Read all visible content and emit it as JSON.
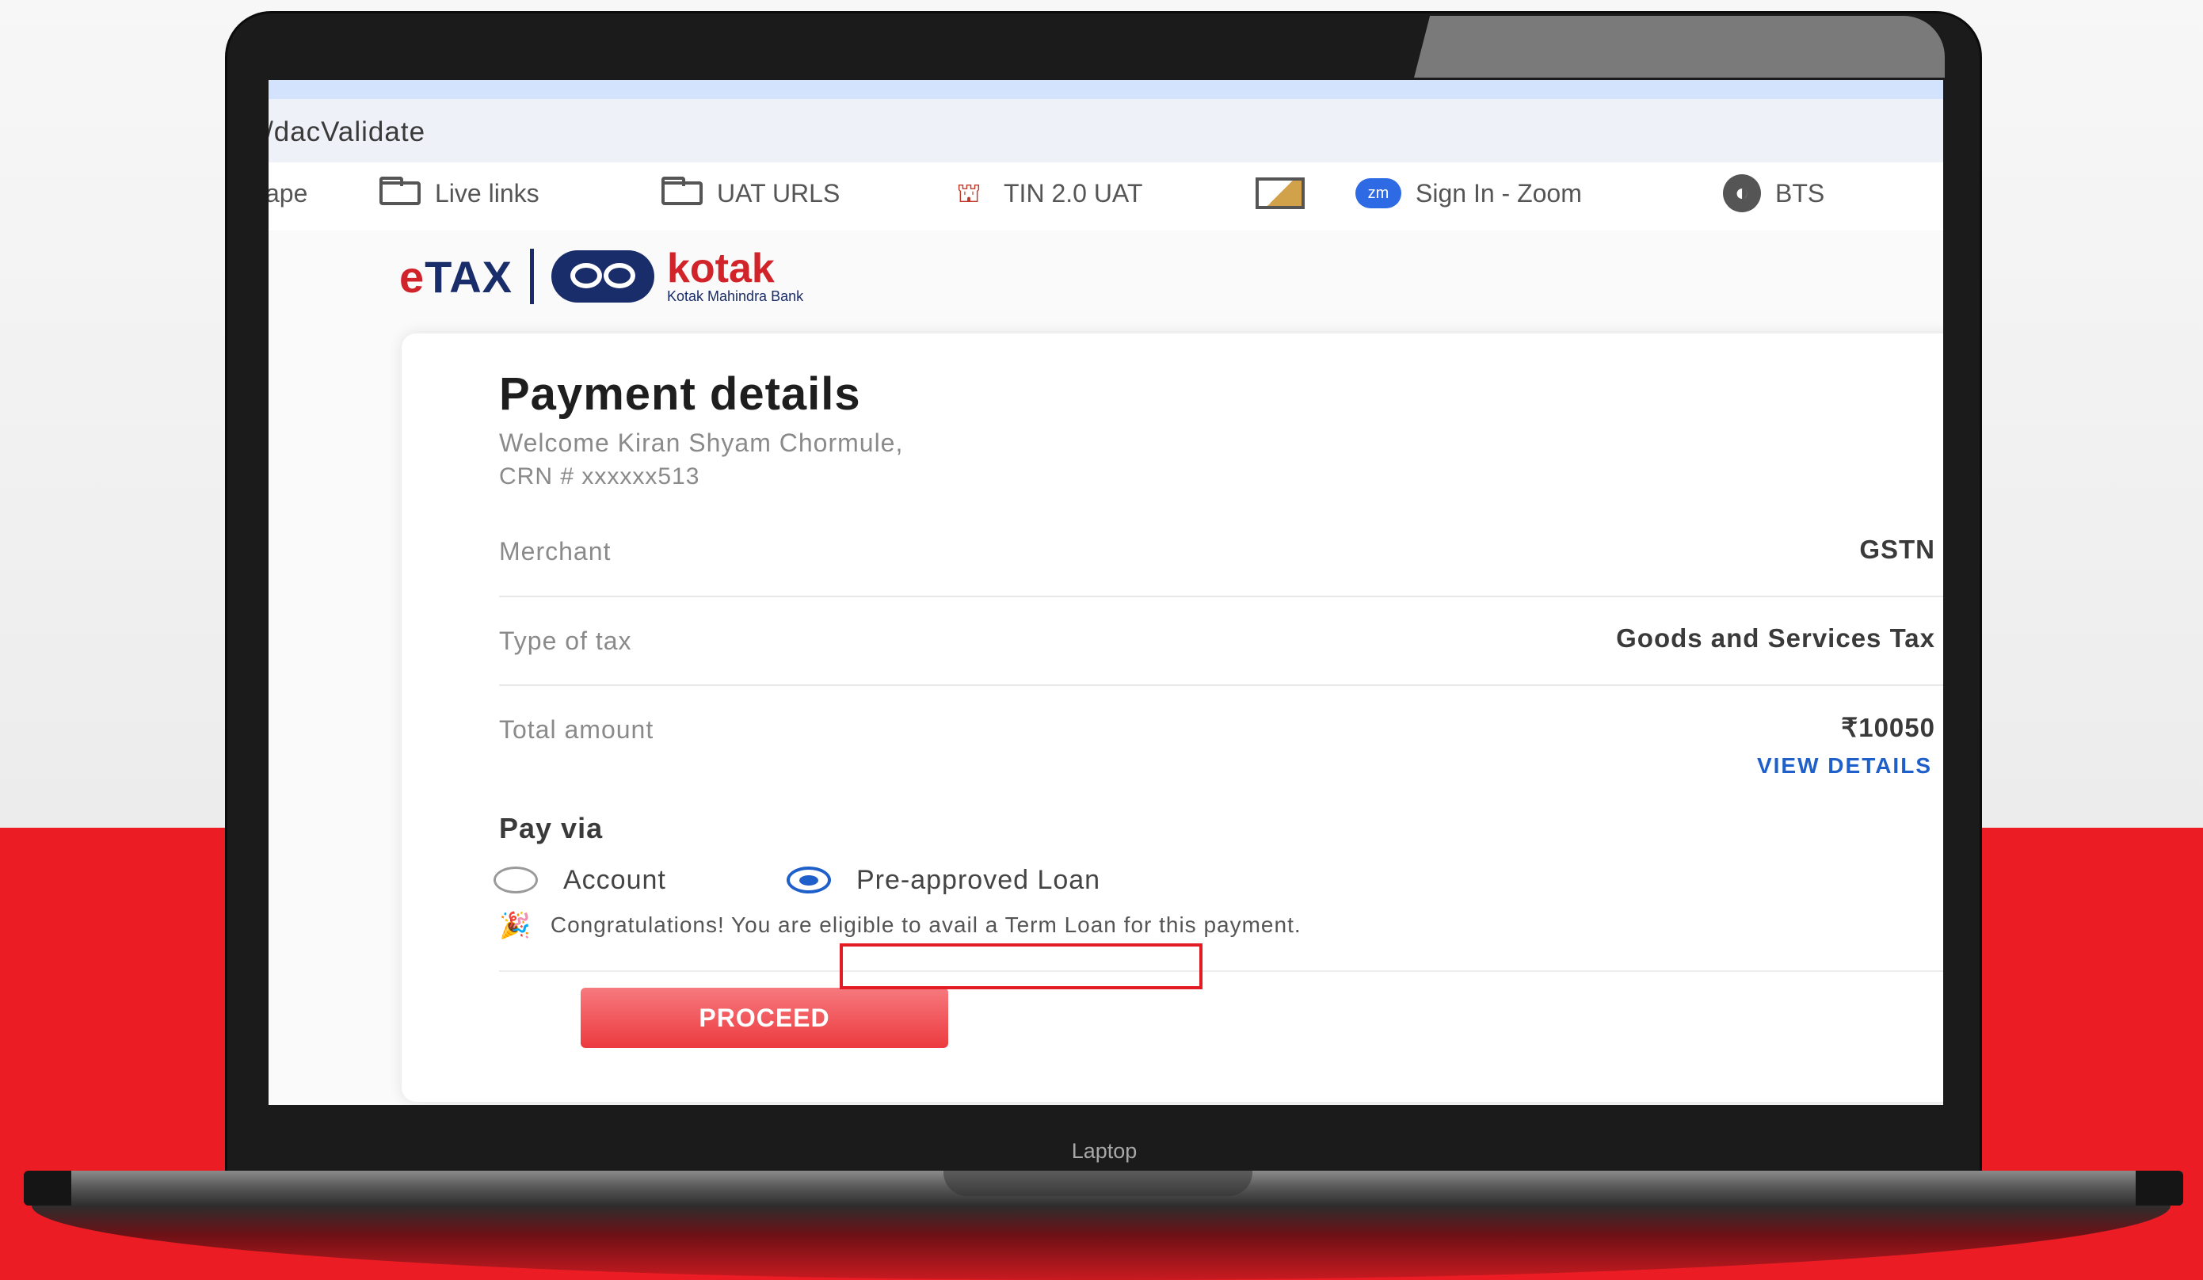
{
  "browser": {
    "url": "/dacValidate",
    "bookmarks": [
      {
        "label": "ape",
        "icon": "none"
      },
      {
        "label": "Live links",
        "icon": "folder-icon"
      },
      {
        "label": "UAT URLS",
        "icon": "folder-icon"
      },
      {
        "label": "TIN 2.0 UAT",
        "icon": "tin-icon"
      },
      {
        "label": "",
        "icon": "image-icon"
      },
      {
        "label": "Sign In - Zoom",
        "icon": "zoom-icon"
      },
      {
        "label": "BTS",
        "icon": "globe-icon"
      }
    ]
  },
  "brand": {
    "etax_prefix": "e",
    "etax_rest": "TAX",
    "bank_name": "kotak",
    "bank_sub": "Kotak Mahindra Bank"
  },
  "payment": {
    "title": "Payment details",
    "welcome": "Welcome Kiran Shyam Chormule,",
    "crn": "CRN # xxxxxx513",
    "merchant_label": "Merchant",
    "merchant_value": "GSTN",
    "tax_type_label": "Type of tax",
    "tax_type_value": "Goods and Services Tax",
    "total_label": "Total amount",
    "total_value": "₹10050",
    "view_details": "VIEW DETAILS",
    "pay_via_label": "Pay via",
    "options": [
      {
        "label": "Account",
        "selected": false
      },
      {
        "label": "Pre-approved Loan",
        "selected": true
      }
    ],
    "congrats": "Congratulations! You are eligible to avail a Term Loan for this payment.",
    "proceed_label": "PROCEED"
  },
  "device_label": "Laptop",
  "colors": {
    "accent_red": "#ec1c24",
    "link_blue": "#1f5fc9",
    "brand_navy": "#1a2d6b"
  }
}
